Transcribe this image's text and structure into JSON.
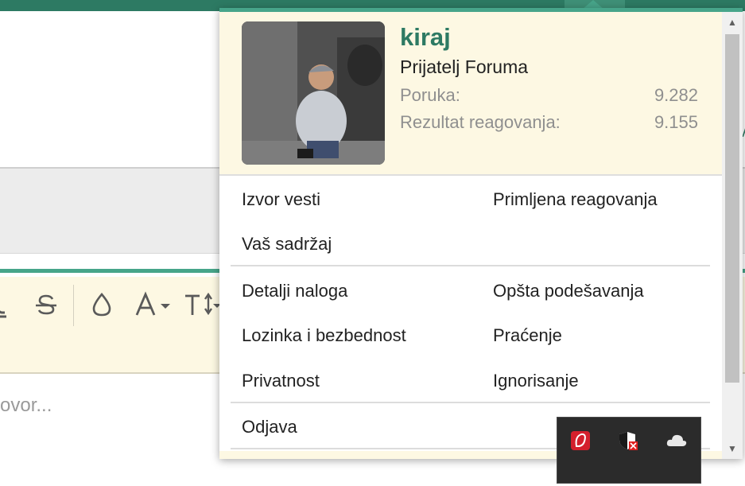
{
  "editor": {
    "placeholder": "ovor..."
  },
  "user": {
    "name": "kiraj",
    "title": "Prijatelj Foruma",
    "stats": [
      {
        "label": "Poruka:",
        "value": "9.282"
      },
      {
        "label": "Rezultat reagovanja:",
        "value": "9.155"
      }
    ]
  },
  "menu": {
    "group1": [
      {
        "label": "Izvor vesti"
      },
      {
        "label": "Primljena reagovanja"
      },
      {
        "label": "Vaš sadržaj"
      }
    ],
    "group2": [
      {
        "label": "Detalji naloga"
      },
      {
        "label": "Opšta podešavanja"
      },
      {
        "label": "Lozinka i bezbednost"
      },
      {
        "label": "Praćenje"
      },
      {
        "label": "Privatnost"
      },
      {
        "label": "Ignorisanje"
      }
    ],
    "logout": "Odjava"
  },
  "tray": {
    "icons": [
      "app-icon",
      "security-shield-icon",
      "cloud-icon"
    ]
  },
  "colors": {
    "accent": "#47a58a",
    "brand": "#2d7a63",
    "header_bg": "#fdf8e3"
  }
}
